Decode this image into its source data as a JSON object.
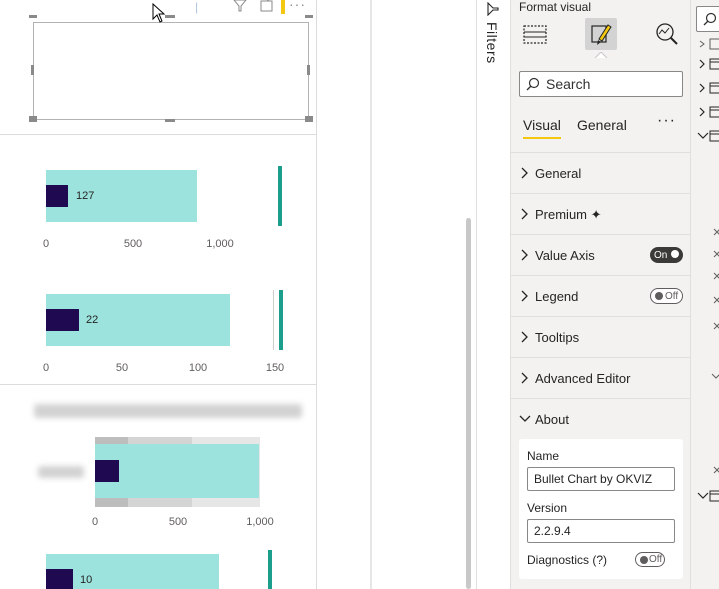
{
  "filters": {
    "label": "Filters"
  },
  "format_pane": {
    "title": "Format visual",
    "search_placeholder": "Search",
    "tabs": {
      "visual": "Visual",
      "general": "General",
      "more": "···"
    },
    "sections": [
      {
        "title": "General"
      },
      {
        "title": "Premium ✦"
      },
      {
        "title": "Value Axis",
        "toggle": "On"
      },
      {
        "title": "Legend",
        "toggle": "Off"
      },
      {
        "title": "Tooltips"
      },
      {
        "title": "Advanced Editor"
      },
      {
        "title": "About"
      }
    ],
    "about": {
      "name_label": "Name",
      "name_value": "Bullet Chart by OKVIZ",
      "version_label": "Version",
      "version_value": "2.2.9.4",
      "diagnostics_label": "Diagnostics (?)",
      "diagnostics_toggle": "Off"
    }
  },
  "colors": {
    "bar_range": "#9be3dc",
    "bar_value": "#1f0a52",
    "target": "#1b9e8b",
    "accent": "#f2c811"
  },
  "chart_data": [
    {
      "type": "bar",
      "title": "",
      "value_label": "127",
      "values": [
        127
      ],
      "range_max": 980,
      "target": 1550,
      "ticks": [
        "0",
        "500",
        "1,000"
      ],
      "xlim": [
        0,
        1140
      ]
    },
    {
      "type": "bar",
      "title": "",
      "value_label": "22",
      "values": [
        22
      ],
      "range_max": 120,
      "target": 154,
      "ticks": [
        "0",
        "50",
        "100",
        "150"
      ],
      "xlim": [
        0,
        150
      ]
    },
    {
      "type": "bar",
      "title": "",
      "values": [
        147
      ],
      "range_max": 1000,
      "ticks": [
        "0",
        "500",
        "1,000"
      ],
      "xlim": [
        0,
        1000
      ]
    },
    {
      "type": "bar",
      "title": "",
      "value_label": "10",
      "values": [
        10
      ],
      "range_max": 65,
      "target": 80,
      "xlim": [
        0,
        82
      ]
    }
  ]
}
